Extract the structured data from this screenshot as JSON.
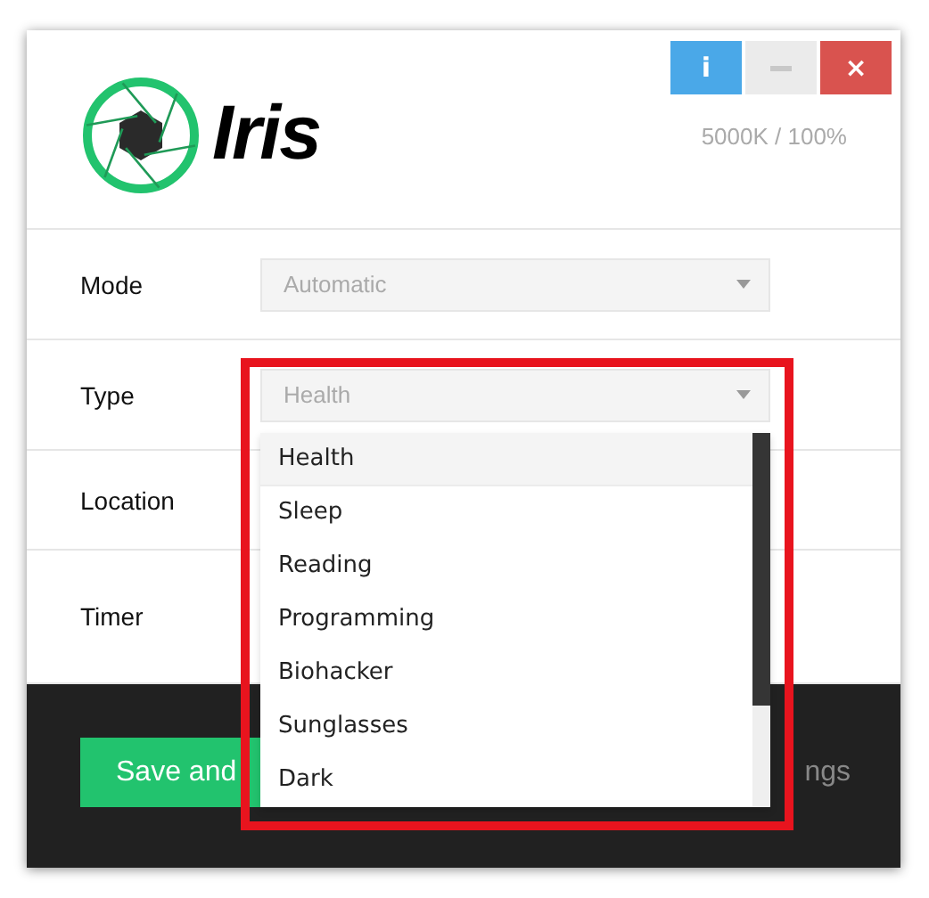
{
  "window": {
    "logo": "Iris",
    "readout": "5000K / 100%",
    "buttons": [
      {
        "kind": "info",
        "label": "i"
      },
      {
        "kind": "minimize"
      },
      {
        "kind": "close",
        "label": "×"
      }
    ]
  },
  "settings": [
    {
      "label": "Mode",
      "select": {
        "value": "Automatic"
      }
    },
    {
      "label": "Type",
      "select": {
        "value": "Health"
      }
    },
    {
      "label": "Location"
    },
    {
      "label": "Timer"
    }
  ],
  "dropdown": {
    "options": [
      {
        "label": "Health",
        "selected": true
      },
      {
        "label": "Sleep",
        "selected": false
      },
      {
        "label": "Reading",
        "selected": false
      },
      {
        "label": "Programming",
        "selected": false
      },
      {
        "label": "Biohacker",
        "selected": false
      },
      {
        "label": "Sunglasses",
        "selected": false
      },
      {
        "label": "Dark",
        "selected": false
      }
    ]
  },
  "footer": {
    "buttons": [
      {
        "kind": "primary",
        "label": "Save and"
      },
      {
        "kind": "link",
        "label": "ngs"
      }
    ]
  }
}
